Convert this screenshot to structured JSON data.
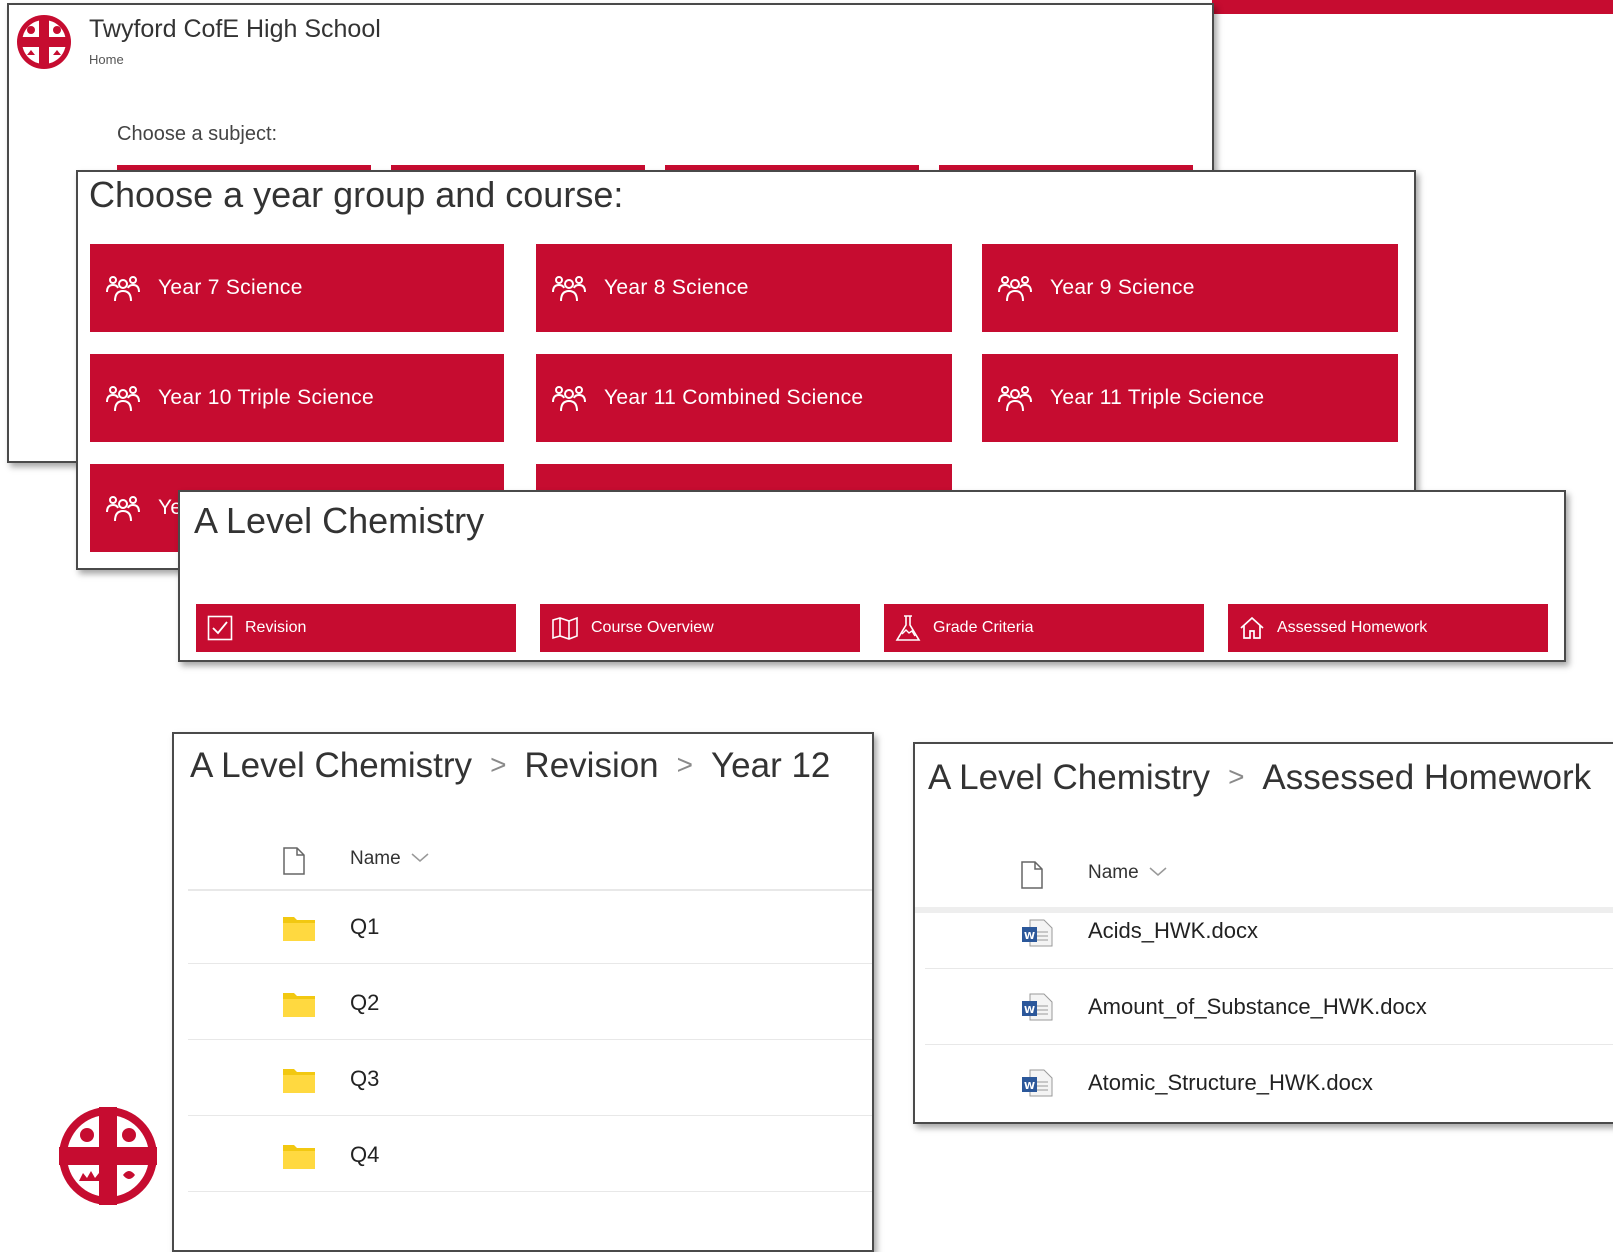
{
  "colors": {
    "brand_red": "#c60c30",
    "folder_yellow": "#f5c518",
    "word_blue": "#2b579a"
  },
  "site": {
    "title": "Twyford CofE High School",
    "breadcrumb": "Home",
    "subject_prompt": "Choose a subject:"
  },
  "year_panel": {
    "heading": "Choose a year group and course:",
    "tiles": [
      {
        "label": "Year 7 Science",
        "icon": "group-icon"
      },
      {
        "label": "Year 8 Science",
        "icon": "group-icon"
      },
      {
        "label": "Year 9 Science",
        "icon": "group-icon"
      },
      {
        "label": "Year 10 Triple Science",
        "icon": "group-icon"
      },
      {
        "label": "Year 11 Combined Science",
        "icon": "group-icon"
      },
      {
        "label": "Year 11 Triple Science",
        "icon": "group-icon"
      },
      {
        "label": "Ye",
        "icon": "group-icon"
      }
    ]
  },
  "chem_panel": {
    "heading": "A Level Chemistry",
    "buttons": [
      {
        "label": "Revision",
        "icon": "checkbox-icon"
      },
      {
        "label": "Course Overview",
        "icon": "map-icon"
      },
      {
        "label": "Grade Criteria",
        "icon": "flask-icon"
      },
      {
        "label": "Assessed Homework",
        "icon": "home-icon"
      }
    ]
  },
  "revision_library": {
    "crumbs": [
      "A Level Chemistry",
      "Revision",
      "Year 12"
    ],
    "name_header": "Name",
    "folders": [
      "Q1",
      "Q2",
      "Q3",
      "Q4"
    ]
  },
  "homework_library": {
    "crumbs": [
      "A Level Chemistry",
      "Assessed Homework"
    ],
    "name_header": "Name",
    "files": [
      "Acids_HWK.docx",
      "Amount_of_Substance_HWK.docx",
      "Atomic_Structure_HWK.docx"
    ]
  }
}
